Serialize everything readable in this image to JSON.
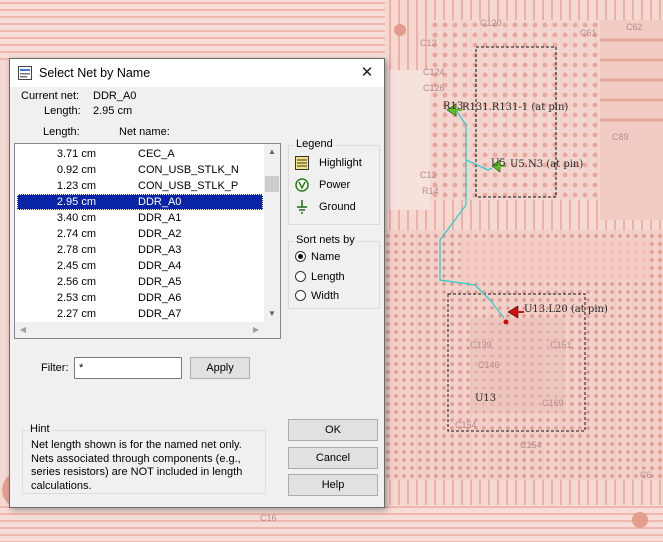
{
  "background": {
    "component_labels": [
      "R13",
      "R131.R131-1 (at pin)",
      "U5",
      "U5.N3 (at pin)",
      "U13.L20 (at pin)",
      "U13"
    ],
    "faint_refs": [
      "C120",
      "C12",
      "C124",
      "C126",
      "C12",
      "R14",
      "C89",
      "C61",
      "C62",
      "C169",
      "C139",
      "C146",
      "C151",
      "C154",
      "C154",
      "C6",
      "C16"
    ],
    "colors": {
      "board": "#f2d3cd",
      "trace": "#f5b6aa",
      "pad": "#e8a090",
      "net_highlight": "#33cccc",
      "marker_green": "#5fbf2a",
      "marker_red": "#cc1010"
    }
  },
  "dialog": {
    "title": "Select Net by Name",
    "close_symbol": "✕",
    "current_net_label": "Current net:",
    "current_net_value": "DDR_A0",
    "length_label": "Length:",
    "length_value": "2.95 cm",
    "col_length": "Length:",
    "col_netname": "Net name:",
    "nets": [
      {
        "length": "3.71 cm",
        "name": "CEC_A",
        "selected": false
      },
      {
        "length": "0.92 cm",
        "name": "CON_USB_STLK_N",
        "selected": false
      },
      {
        "length": "1.23 cm",
        "name": "CON_USB_STLK_P",
        "selected": false
      },
      {
        "length": "2.95 cm",
        "name": "DDR_A0",
        "selected": true
      },
      {
        "length": "3.40 cm",
        "name": "DDR_A1",
        "selected": false
      },
      {
        "length": "2.74 cm",
        "name": "DDR_A2",
        "selected": false
      },
      {
        "length": "2.78 cm",
        "name": "DDR_A3",
        "selected": false
      },
      {
        "length": "2.45 cm",
        "name": "DDR_A4",
        "selected": false
      },
      {
        "length": "2.56 cm",
        "name": "DDR_A5",
        "selected": false
      },
      {
        "length": "2.53 cm",
        "name": "DDR_A6",
        "selected": false
      },
      {
        "length": "2.27 cm",
        "name": "DDR_A7",
        "selected": false
      }
    ],
    "legend": {
      "title": "Legend",
      "items": [
        {
          "icon": "highlight-icon",
          "label": "Highlight"
        },
        {
          "icon": "power-icon",
          "label": "Power"
        },
        {
          "icon": "ground-icon",
          "label": "Ground"
        }
      ]
    },
    "sort": {
      "title": "Sort nets by",
      "options": [
        {
          "label": "Name",
          "checked": true
        },
        {
          "label": "Length",
          "checked": false
        },
        {
          "label": "Width",
          "checked": false
        }
      ]
    },
    "filter_label": "Filter:",
    "filter_value": "*",
    "apply_label": "Apply",
    "hint_title": "Hint",
    "hint_text": "Net length shown is for the named net only.  Nets associated through components (e.g., series resistors) are NOT included in length calculations.",
    "ok_label": "OK",
    "cancel_label": "Cancel",
    "help_label": "Help",
    "accent": "#0a24a8"
  }
}
